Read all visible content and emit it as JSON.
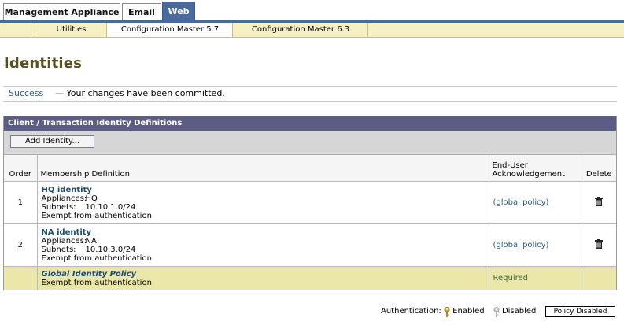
{
  "top_tabs": [
    "Management Appliance",
    "Email",
    "Web"
  ],
  "sub_tabs": [
    "Utilities",
    "Configuration Master 5.7",
    "Configuration Master 6.3"
  ],
  "page_title": "Identities",
  "message": {
    "status": "Success",
    "text": "— Your changes have been committed."
  },
  "panel": {
    "title": "Client / Transaction Identity Definitions",
    "add_button": "Add Identity...",
    "columns": {
      "order": "Order",
      "membership": "Membership Definition",
      "ack_line1": "End-User",
      "ack_line2": "Acknowledgement",
      "delete": "Delete"
    },
    "rows": [
      {
        "order": "1",
        "name": "HQ identity",
        "appliances_label": "Appliances:",
        "appliances": "HQ",
        "subnets_label": "Subnets:",
        "subnets": "10.10.1.0/24",
        "auth": "Exempt from authentication",
        "ack": "(global policy)"
      },
      {
        "order": "2",
        "name": "NA identity",
        "appliances_label": "Appliances:",
        "appliances": "NA",
        "subnets_label": "Subnets:",
        "subnets": "10.10.3.0/24",
        "auth": "Exempt from authentication",
        "ack": "(global policy)"
      }
    ],
    "global": {
      "name": "Global Identity Policy",
      "auth": "Exempt from authentication",
      "ack": "Required"
    }
  },
  "footer": {
    "label": "Authentication:",
    "enabled": "Enabled",
    "disabled": "Disabled",
    "policy_button": "Policy Disabled"
  },
  "icons": {
    "delete": "trash-icon",
    "enabled": "key-enabled-icon",
    "disabled": "key-disabled-icon"
  },
  "colors": {
    "active_tab": "#4a6a9c",
    "panel_header": "#5c5c84",
    "subtab_bg": "#f5f1c4",
    "global_row": "#ebe7a8",
    "title": "#585020"
  }
}
